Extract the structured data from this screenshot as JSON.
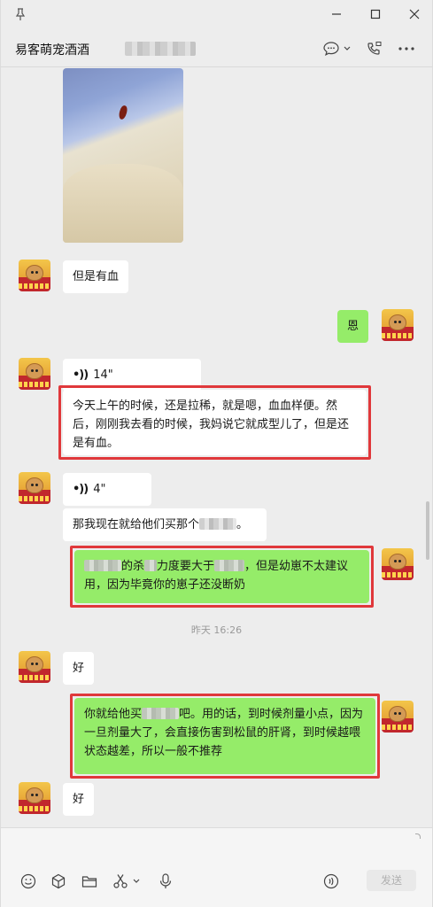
{
  "header": {
    "chat_title": "易客萌宠酒酒"
  },
  "messages": {
    "m1_text": "但是有血",
    "m2_text": "恩",
    "m3_voice": "14\"",
    "m4_text": "今天上午的时候，还是拉稀，就是嗯，血血样便。然后，刚刚我去看的时候，我妈说它就成型儿了，但是还是有血。",
    "m5_voice": "4\"",
    "m6_pre": "那我现在就给他们买那个",
    "m6_post": "。",
    "m7_a": "的杀",
    "m7_b": "力度要大于",
    "m7_c": "，但是幼崽不太建议用，因为毕竟你的崽子还没断奶",
    "timestamp": "昨天 16:26",
    "m8_text": "好",
    "m9_a": "你就给他买",
    "m9_b": "吧。用的话，到时候剂量小点，因为一旦剂量大了，会直接伤害到松鼠的肝肾，到时候越喂状态越差，所以一般不推荐",
    "m10_text": "好"
  },
  "input": {
    "send_label": "发送"
  },
  "icons": [
    "pin-icon",
    "minimize-icon",
    "maximize-icon",
    "close-icon",
    "chat-icon",
    "video-call-icon",
    "more-icon",
    "emoji-icon",
    "favorite-icon",
    "folder-icon",
    "scissors-icon",
    "microphone-icon",
    "voice-input-icon"
  ],
  "colors": {
    "incoming_bubble": "#ffffff",
    "outgoing_bubble": "#95ec69",
    "highlight_box": "#e0383b"
  }
}
